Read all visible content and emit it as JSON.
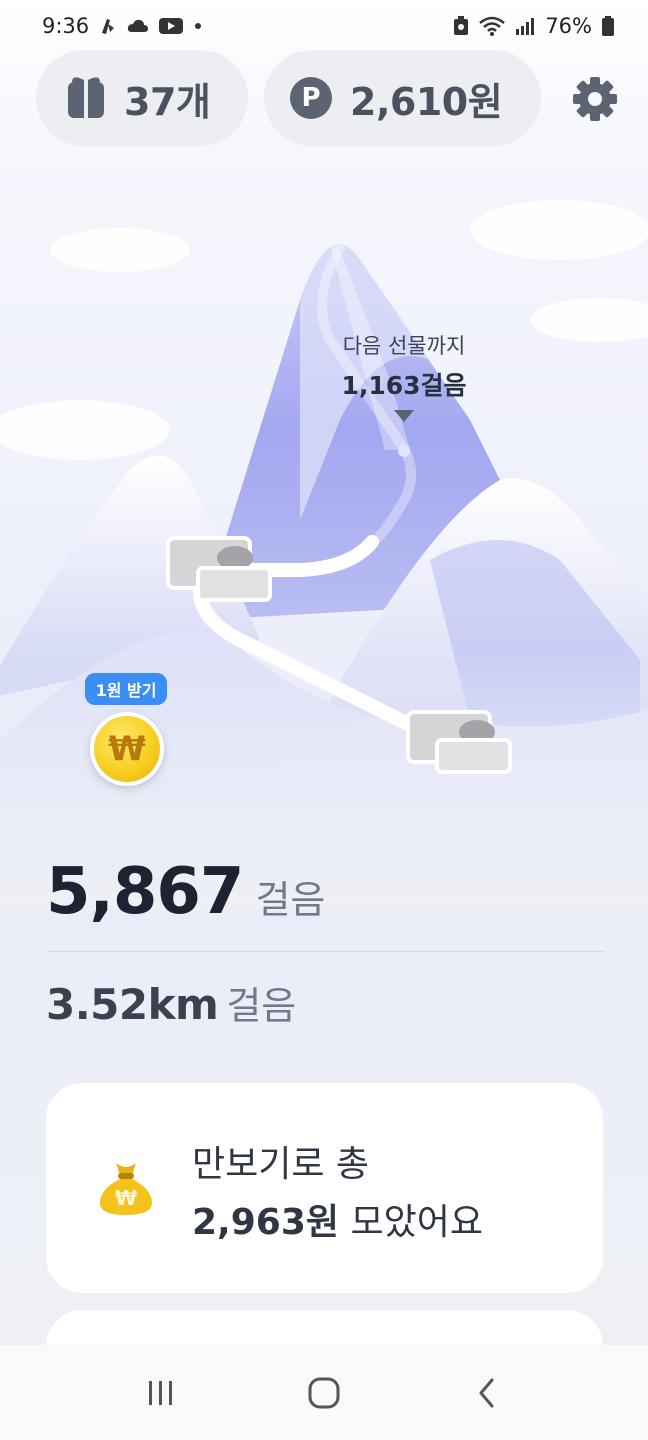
{
  "status_bar": {
    "time": "9:36",
    "battery": "76%",
    "icons": [
      "notification-icon",
      "cloud-icon",
      "youtube-icon",
      "dot-icon",
      "recycle-icon",
      "wifi-icon",
      "signal-icon",
      "battery-icon"
    ]
  },
  "header": {
    "gift_count": "37개",
    "points": "2,610원",
    "point_badge": "P",
    "icons": [
      "gift-icon",
      "point-icon",
      "gear-icon"
    ]
  },
  "next_gift": {
    "label": "다음 선물까지",
    "steps": "1,163걸음"
  },
  "reward": {
    "badge": "1원 받기",
    "coin_symbol": "₩"
  },
  "stats": {
    "steps": "5,867",
    "steps_unit": "걸음",
    "distance": "3.52km",
    "distance_unit": "걸음"
  },
  "total_card": {
    "line1": "만보기로 총",
    "amount": "2,963원",
    "line2_suffix": "모았어요",
    "icon": "money-bag-icon"
  },
  "nav": {
    "icons": [
      "recent-apps-icon",
      "home-icon",
      "back-icon"
    ]
  },
  "colors": {
    "accent_blue": "#3a8ef6",
    "coin_gold": "#f8cf22",
    "mountain_purple": "#a9aef2"
  }
}
